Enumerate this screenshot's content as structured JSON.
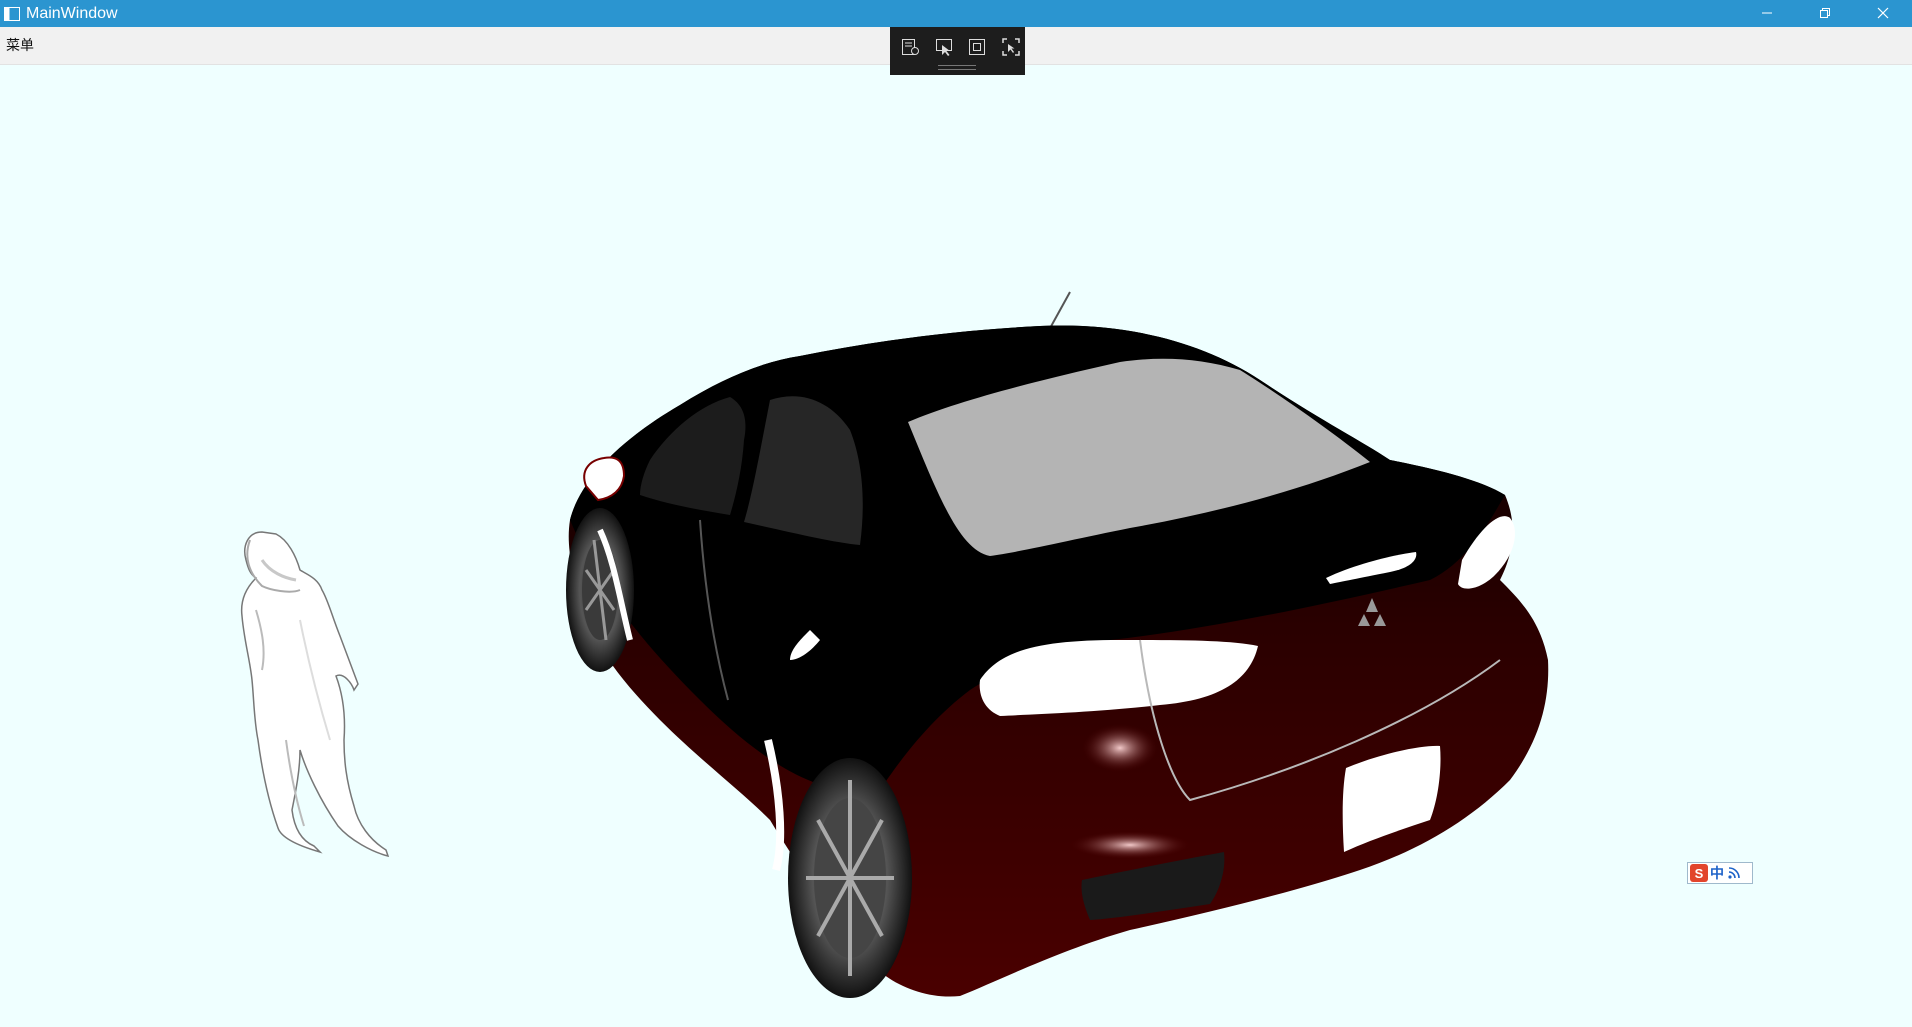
{
  "window": {
    "title": "MainWindow",
    "accent_color": "#2b95d0",
    "controls": [
      "minimize-icon",
      "restore-icon",
      "close-icon"
    ]
  },
  "menu": {
    "items": [
      {
        "label": "菜单"
      }
    ]
  },
  "devtools": {
    "buttons": [
      "live-visual-tree-icon",
      "select-element-icon",
      "display-layout-adorners-icon",
      "track-focus-icon"
    ]
  },
  "viewport": {
    "background_color": "#efffff",
    "car_body_color": "#420000",
    "objects": [
      "human-figure-model",
      "car-model"
    ]
  },
  "ime": {
    "logo_label": "S",
    "mode_label": "中"
  }
}
